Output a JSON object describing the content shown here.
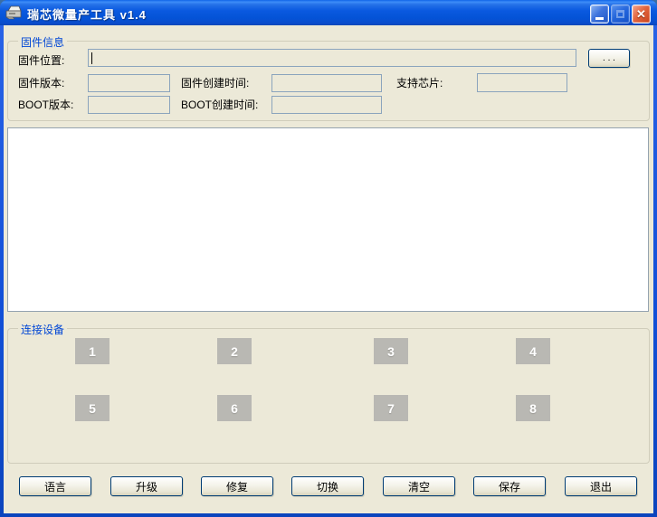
{
  "window": {
    "title": "瑞芯微量产工具 v1.4"
  },
  "titlebar": {
    "close_glyph": "✕"
  },
  "firmware_group": {
    "title": "固件信息",
    "location_label": "固件位置:",
    "location_value": "",
    "browse_label": ". . .",
    "fw_version_label": "固件版本:",
    "fw_version_value": "",
    "fw_time_label": "固件创建时间:",
    "fw_time_value": "",
    "chip_label": "支持芯片:",
    "chip_value": "",
    "boot_version_label": "BOOT版本:",
    "boot_version_value": "",
    "boot_time_label": "BOOT创建时间:",
    "boot_time_value": ""
  },
  "log_area": {
    "content": ""
  },
  "devices_group": {
    "title": "连接设备",
    "slots": [
      "1",
      "2",
      "3",
      "4",
      "5",
      "6",
      "7",
      "8"
    ]
  },
  "toolbar": {
    "buttons": [
      {
        "label": "语言"
      },
      {
        "label": "升级"
      },
      {
        "label": "修复"
      },
      {
        "label": "切换"
      },
      {
        "label": "清空"
      },
      {
        "label": "保存"
      },
      {
        "label": "退出"
      }
    ]
  },
  "colors": {
    "titlebar_blue": "#0a59e0",
    "body_background": "#ece9d8",
    "group_label_blue": "#0046d5",
    "input_border": "#8ba4bd",
    "device_slot_gray": "#b9b8b3",
    "close_button_red": "#c9421c",
    "button_border_blue": "#003c74"
  }
}
